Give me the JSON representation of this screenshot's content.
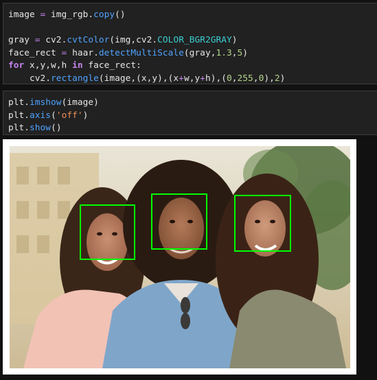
{
  "cells": [
    {
      "lines": [
        [
          [
            "plain",
            "image "
          ],
          [
            "op",
            "="
          ],
          [
            "plain",
            " img_rgb."
          ],
          [
            "fn",
            "copy"
          ],
          [
            "plain",
            "()"
          ]
        ],
        [],
        [
          [
            "plain",
            "gray "
          ],
          [
            "op",
            "="
          ],
          [
            "plain",
            " cv2."
          ],
          [
            "fn",
            "cvtColor"
          ],
          [
            "plain",
            "(img,cv2."
          ],
          [
            "const",
            "COLOR_BGR2GRAY"
          ],
          [
            "plain",
            ")"
          ]
        ],
        [
          [
            "plain",
            "face_rect "
          ],
          [
            "op",
            "="
          ],
          [
            "plain",
            " haar."
          ],
          [
            "fn",
            "detectMultiScale"
          ],
          [
            "plain",
            "(gray,"
          ],
          [
            "num",
            "1.3"
          ],
          [
            "plain",
            ","
          ],
          [
            "num",
            "5"
          ],
          [
            "plain",
            ")"
          ]
        ],
        [
          [
            "kw",
            "for"
          ],
          [
            "plain",
            " x,y,w,h "
          ],
          [
            "kw",
            "in"
          ],
          [
            "plain",
            " face_rect:"
          ]
        ],
        [
          [
            "plain",
            "    cv2."
          ],
          [
            "fn",
            "rectangle"
          ],
          [
            "plain",
            "(image,(x,y),(x"
          ],
          [
            "op",
            "+"
          ],
          [
            "plain",
            "w,y"
          ],
          [
            "op",
            "+"
          ],
          [
            "plain",
            "h),("
          ],
          [
            "num",
            "0"
          ],
          [
            "plain",
            ","
          ],
          [
            "num",
            "255"
          ],
          [
            "plain",
            ","
          ],
          [
            "num",
            "0"
          ],
          [
            "plain",
            "),"
          ],
          [
            "num",
            "2"
          ],
          [
            "plain",
            ")"
          ]
        ]
      ]
    },
    {
      "lines": [
        [
          [
            "plain",
            "plt."
          ],
          [
            "fn",
            "imshow"
          ],
          [
            "plain",
            "(image)"
          ]
        ],
        [
          [
            "plain",
            "plt."
          ],
          [
            "fn",
            "axis"
          ],
          [
            "plain",
            "("
          ],
          [
            "str",
            "'off'"
          ],
          [
            "plain",
            ")"
          ]
        ],
        [
          [
            "plain",
            "plt."
          ],
          [
            "fn",
            "show"
          ],
          [
            "plain",
            "()"
          ]
        ]
      ]
    }
  ],
  "output": {
    "image_description_name": "detected-faces-photo",
    "face_box_color": "#00ff00",
    "face_count": 3
  },
  "colors": {
    "cell_bg": "#212121",
    "keyword": "#c586f0",
    "function": "#4fa3ff",
    "number": "#b5d68a",
    "constant": "#3ccfd3",
    "string": "#f08f57"
  }
}
